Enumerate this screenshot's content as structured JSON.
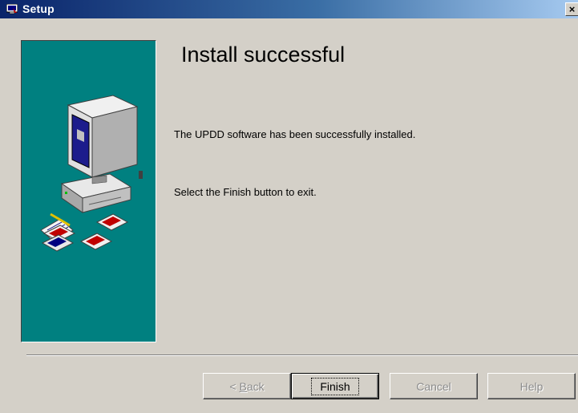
{
  "window": {
    "title": "Setup",
    "icon": "setup-app-icon",
    "close_label": "×"
  },
  "page": {
    "title": "Install successful",
    "message": "The UPDD software has been successfully installed.",
    "instruction": "Select the Finish button to exit."
  },
  "side_panel": {
    "art": "computer-with-disks-illustration",
    "color": "#008080"
  },
  "buttons": {
    "back": {
      "accel": "B",
      "rest": "ack",
      "prefix": "< ",
      "enabled": false
    },
    "finish": {
      "label": "Finish",
      "enabled": true,
      "default": true
    },
    "cancel": {
      "label": "Cancel",
      "enabled": false
    },
    "help": {
      "label": "Help",
      "enabled": false
    }
  }
}
